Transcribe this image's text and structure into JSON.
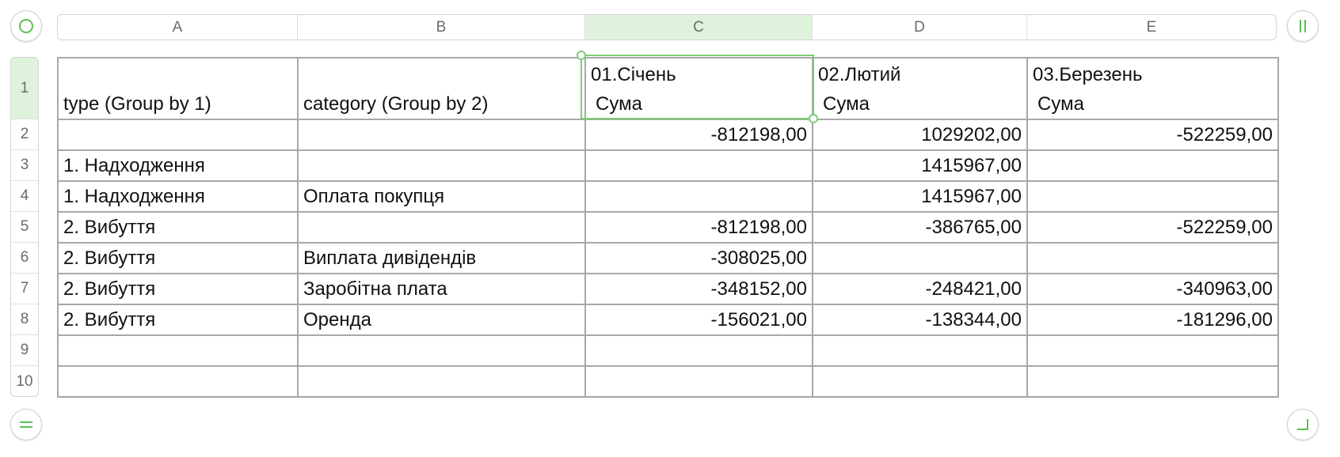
{
  "columns": [
    "A",
    "B",
    "C",
    "D",
    "E"
  ],
  "rows": [
    "1",
    "2",
    "3",
    "4",
    "5",
    "6",
    "7",
    "8",
    "9",
    "10"
  ],
  "selected_column": "C",
  "selected_row": "1",
  "header": {
    "a": "type (Group by 1)",
    "b": "category (Group by 2)",
    "c1": "01.Січень",
    "c2": "Сума",
    "d1": "02.Лютий",
    "d2": "Сума",
    "e1": "03.Березень",
    "e2": "Сума"
  },
  "cells": [
    [
      "",
      "",
      "-812198,00",
      "1029202,00",
      "-522259,00"
    ],
    [
      "1. Надходження",
      "",
      "",
      "1415967,00",
      ""
    ],
    [
      "1. Надходження",
      "Оплата покупця",
      "",
      "1415967,00",
      ""
    ],
    [
      "2. Вибуття",
      "",
      "-812198,00",
      "-386765,00",
      "-522259,00"
    ],
    [
      "2. Вибуття",
      "Виплата дивідендів",
      "-308025,00",
      "",
      ""
    ],
    [
      "2. Вибуття",
      "Заробітна плата",
      "-348152,00",
      "-248421,00",
      "-340963,00"
    ],
    [
      "2. Вибуття",
      "Оренда",
      "-156021,00",
      "-138344,00",
      "-181296,00"
    ],
    [
      "",
      "",
      "",
      "",
      ""
    ],
    [
      "",
      "",
      "",
      "",
      ""
    ]
  ],
  "colors": {
    "accent": "#7ccf74",
    "selection_fill": "#dff3dc",
    "gridline": "#a8a8a8"
  },
  "icons": {
    "select_all": "circle-icon",
    "column_handle": "pause-bars-icon",
    "row_handle": "equals-bars-icon",
    "resize": "corner-resize-icon"
  }
}
